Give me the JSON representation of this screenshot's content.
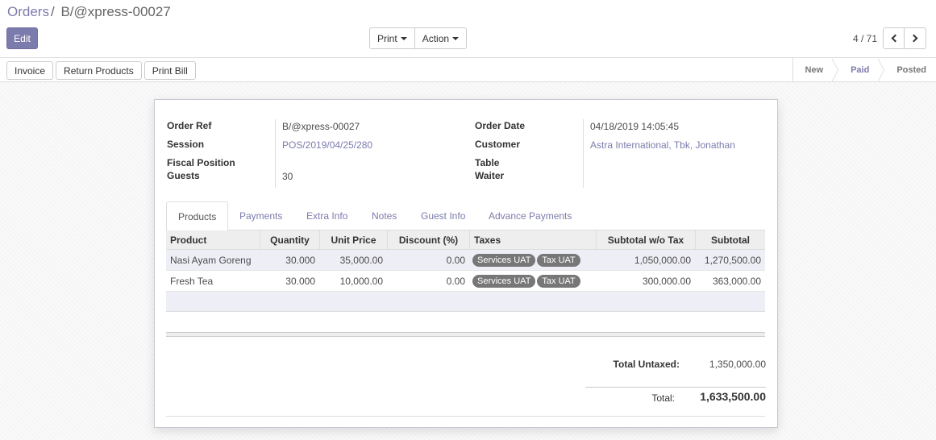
{
  "breadcrumb": {
    "parent": "Orders",
    "separator": "/",
    "current": "B/@xpress-00027"
  },
  "buttons": {
    "edit": "Edit",
    "print": "Print",
    "action": "Action"
  },
  "pager": {
    "value": "4 / 71"
  },
  "statusbar": {
    "buttons": [
      "Invoice",
      "Return Products",
      "Print Bill"
    ],
    "stages": [
      "New",
      "Paid",
      "Posted"
    ],
    "active_stage": "Paid"
  },
  "form": {
    "order_ref_label": "Order Ref",
    "order_ref": "B/@xpress-00027",
    "session_label": "Session",
    "session": "POS/2019/04/25/280",
    "fiscal_position_label": "Fiscal Position",
    "guests_label": "Guests",
    "guests": "30",
    "order_date_label": "Order Date",
    "order_date": "04/18/2019 14:05:45",
    "customer_label": "Customer",
    "customer": "Astra International, Tbk, Jonathan",
    "table_label": "Table",
    "waiter_label": "Waiter"
  },
  "tabs": [
    "Products",
    "Payments",
    "Extra Info",
    "Notes",
    "Guest Info",
    "Advance Payments"
  ],
  "table": {
    "headers": [
      "Product",
      "Quantity",
      "Unit Price",
      "Discount (%)",
      "Taxes",
      "Subtotal w/o Tax",
      "Subtotal"
    ],
    "rows": [
      {
        "product": "Nasi Ayam Goreng",
        "quantity": "30.000",
        "unit_price": "35,000.00",
        "discount": "0.00",
        "taxes": [
          "Services UAT",
          "Tax UAT"
        ],
        "subtotal_wo_tax": "1,050,000.00",
        "subtotal": "1,270,500.00"
      },
      {
        "product": "Fresh Tea",
        "quantity": "30.000",
        "unit_price": "10,000.00",
        "discount": "0.00",
        "taxes": [
          "Services UAT",
          "Tax UAT"
        ],
        "subtotal_wo_tax": "300,000.00",
        "subtotal": "363,000.00"
      }
    ]
  },
  "totals": {
    "untaxed_label": "Total Untaxed:",
    "untaxed": "1,350,000.00",
    "total_label": "Total:",
    "total": "1,633,500.00"
  },
  "colors": {
    "accent": "#7c7bad",
    "badge": "#777777"
  }
}
